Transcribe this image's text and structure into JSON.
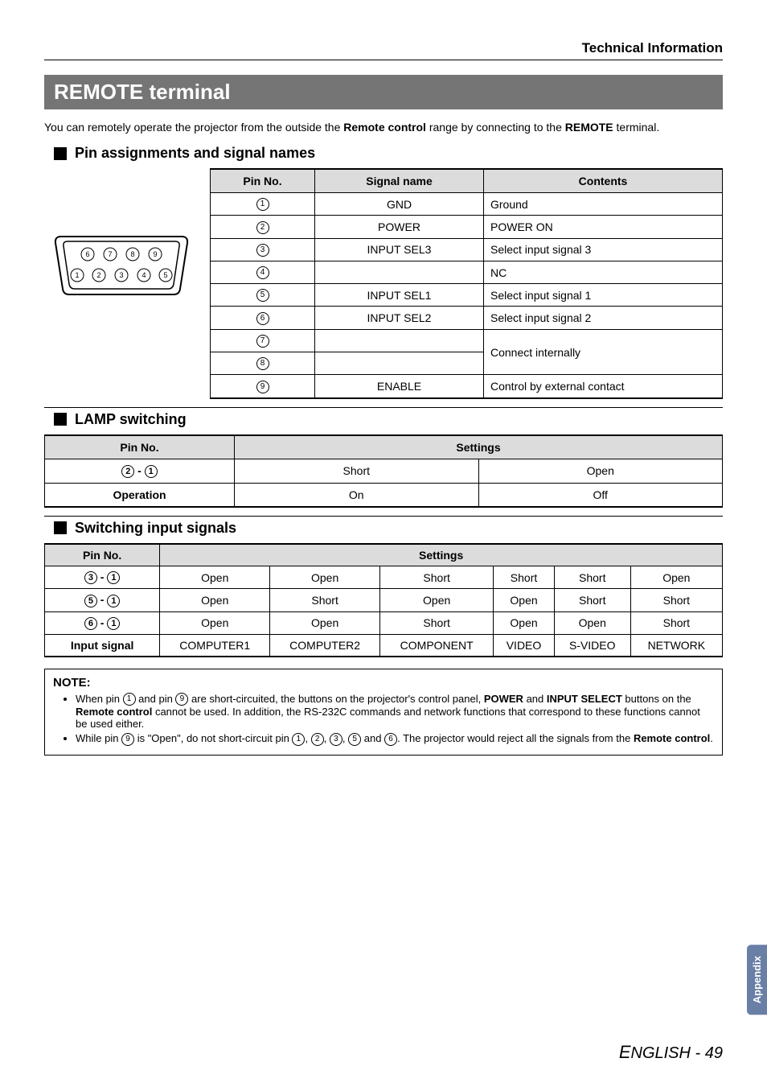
{
  "header": {
    "title": "Technical Information"
  },
  "title": "REMOTE terminal",
  "intro_a": "You can remotely operate the projector from the outside the ",
  "intro_b": "Remote control",
  "intro_c": " range by connecting to the ",
  "intro_d": "REMOTE",
  "intro_e": " terminal.",
  "sec_pin": {
    "heading": "Pin assignments and signal names",
    "th_pin": "Pin No.",
    "th_sig": "Signal name",
    "th_cont": "Contents",
    "rows": [
      {
        "pin": "1",
        "sig": "GND",
        "cont": "Ground"
      },
      {
        "pin": "2",
        "sig": "POWER",
        "cont": "POWER ON"
      },
      {
        "pin": "3",
        "sig": "INPUT SEL3",
        "cont": "Select input signal 3"
      },
      {
        "pin": "4",
        "sig": "",
        "cont": "NC"
      },
      {
        "pin": "5",
        "sig": "INPUT SEL1",
        "cont": "Select input signal 1"
      },
      {
        "pin": "6",
        "sig": "INPUT SEL2",
        "cont": "Select input signal 2"
      },
      {
        "pin": "7",
        "sig": "",
        "cont": "Connect internally"
      },
      {
        "pin": "8",
        "sig": "",
        "cont": ""
      },
      {
        "pin": "9",
        "sig": "ENABLE",
        "cont": "Control by external contact"
      }
    ]
  },
  "sec_lamp": {
    "heading": "LAMP switching",
    "th_pin": "Pin No.",
    "th_set": "Settings",
    "row1_label_a": "2",
    "row1_label_dash": " - ",
    "row1_label_b": "1",
    "row1_c1": "Short",
    "row1_c2": "Open",
    "row2_label": "Operation",
    "row2_c1": "On",
    "row2_c2": "Off"
  },
  "sec_input": {
    "heading": "Switching input signals",
    "th_pin": "Pin No.",
    "th_set": "Settings",
    "r1": {
      "a": "3",
      "b": "1",
      "v": [
        "Open",
        "Open",
        "Short",
        "Short",
        "Short",
        "Open"
      ]
    },
    "r2": {
      "a": "5",
      "b": "1",
      "v": [
        "Open",
        "Short",
        "Open",
        "Open",
        "Short",
        "Short"
      ]
    },
    "r3": {
      "a": "6",
      "b": "1",
      "v": [
        "Open",
        "Open",
        "Short",
        "Open",
        "Open",
        "Short"
      ]
    },
    "r4_label": "Input signal",
    "r4_v": [
      "COMPUTER1",
      "COMPUTER2",
      "COMPONENT",
      "VIDEO",
      "S-VIDEO",
      "NETWORK"
    ]
  },
  "note": {
    "title": "NOTE:",
    "n1a": "When pin ",
    "n1b": " and pin ",
    "n1c": " are short-circuited, the buttons on the projector's control panel, ",
    "n1d": "POWER",
    "n1e": " and ",
    "n1f": "INPUT SELECT",
    "n1g": " buttons on the ",
    "n1h": "Remote control",
    "n1i": " cannot be used. In addition, the RS-232C commands and network functions that correspond to these functions cannot be used either.",
    "n1p1": "1",
    "n1p9": "9",
    "n2a": "While pin ",
    "n2b": " is \"Open\", do not short-circuit pin ",
    "n2c": ". The projector would reject all the signals from the ",
    "n2d": "Remote control",
    "n2e": ".",
    "n2p9": "9",
    "n2p1": "1",
    "n2p2": "2",
    "n2p3": "3",
    "n2p5": "5",
    "n2p6": "6",
    "n2sep": ", ",
    "n2and": " and "
  },
  "footer": {
    "tab": "Appendix",
    "lang": "English",
    "sep": " - ",
    "page": "49"
  }
}
